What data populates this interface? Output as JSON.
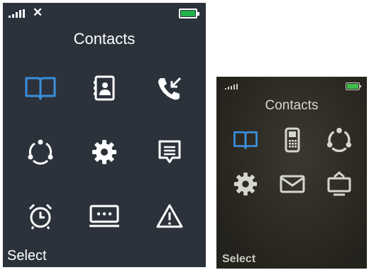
{
  "screen_a": {
    "status": {
      "no_service_mark": "✕",
      "battery_color": "#22b14c"
    },
    "title": "Contacts",
    "menu": [
      {
        "icon": "book-icon",
        "color": "#3a8fdc"
      },
      {
        "icon": "contact-card-icon",
        "color": "#ffffff"
      },
      {
        "icon": "call-log-icon",
        "color": "#ffffff"
      },
      {
        "icon": "refresh-circle-icon",
        "color": "#ffffff"
      },
      {
        "icon": "gear-icon",
        "color": "#ffffff"
      },
      {
        "icon": "message-icon",
        "color": "#ffffff"
      },
      {
        "icon": "alarm-clock-icon",
        "color": "#ffffff"
      },
      {
        "icon": "keyboard-icon",
        "color": "#ffffff"
      },
      {
        "icon": "warning-icon",
        "color": "#ffffff"
      }
    ],
    "softkey_left": "Select"
  },
  "screen_b": {
    "status": {
      "battery_color": "#3fbf4a"
    },
    "title": "Contacts",
    "menu": [
      {
        "icon": "book-icon",
        "color": "#3a8fdc"
      },
      {
        "icon": "mobile-phone-icon",
        "color": "#d6d6d0"
      },
      {
        "icon": "refresh-circle-icon",
        "color": "#d6d6d0"
      },
      {
        "icon": "gear-icon",
        "color": "#d6d6d0"
      },
      {
        "icon": "envelope-icon",
        "color": "#d6d6d0"
      },
      {
        "icon": "display-icon",
        "color": "#d6d6d0"
      }
    ],
    "softkey_left": "Select"
  }
}
